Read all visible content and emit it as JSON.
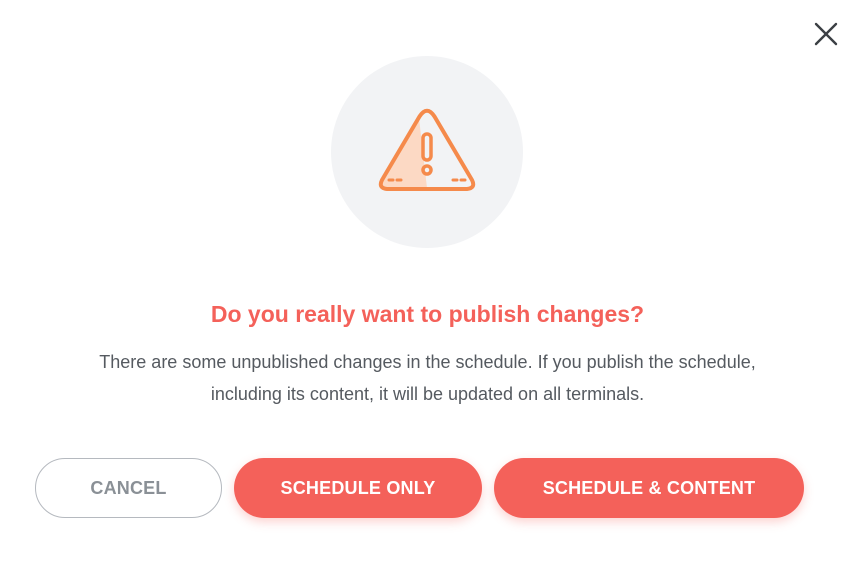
{
  "dialog": {
    "close_icon": "close-icon",
    "warning_icon": "warning-triangle-icon",
    "title": "Do you really want to publish changes?",
    "message_line1": "There are some unpublished changes in the schedule. If you publish the schedule,",
    "message_line2": "including its content, it will be updated on all terminals.",
    "buttons": {
      "cancel": "CANCEL",
      "schedule_only": "SCHEDULE ONLY",
      "schedule_and_content": "SCHEDULE & CONTENT"
    }
  },
  "colors": {
    "accent": "#f4615a",
    "warning_stroke": "#f58a4b",
    "warning_fill": "#fcd9c4",
    "icon_background": "#f2f3f5",
    "body_text": "#555a60",
    "cancel_text": "#8a9096"
  }
}
